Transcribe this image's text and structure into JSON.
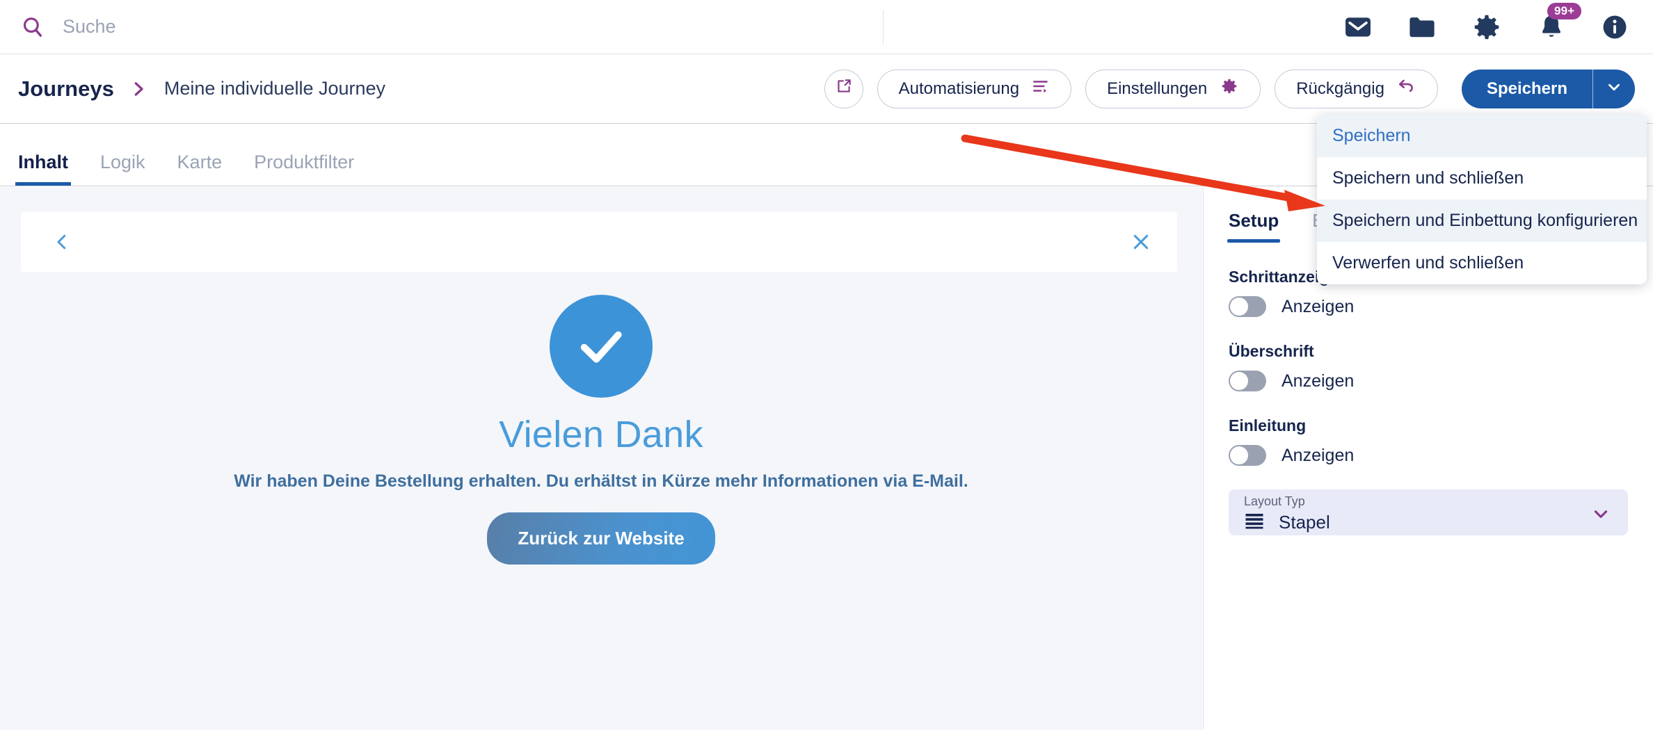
{
  "topbar": {
    "search": {
      "placeholder": "Suche",
      "value": "",
      "icon": "search-icon"
    },
    "icons": [
      {
        "name": "mail-icon",
        "label": "Mail"
      },
      {
        "name": "folder-icon",
        "label": "Ordner"
      },
      {
        "name": "gear-icon",
        "label": "Einstellungen"
      },
      {
        "name": "bell-icon",
        "label": "Benachrichtigungen",
        "badge": "99+"
      },
      {
        "name": "info-icon",
        "label": "Info"
      }
    ],
    "badge_color": "#9b3c96",
    "icon_color": "#233a5e"
  },
  "actionbar": {
    "breadcrumb_root": "Journeys",
    "breadcrumb_leaf": "Meine individuelle Journey",
    "open_external_label": "",
    "automation_label": "Automatisierung",
    "settings_label": "Einstellungen",
    "undo_label": "Rückgängig",
    "save_label": "Speichern",
    "accent_purple": "#8a3a8c",
    "primary_blue": "#1c5aa8"
  },
  "tabs": [
    {
      "label": "Inhalt",
      "active": true
    },
    {
      "label": "Logik",
      "active": false
    },
    {
      "label": "Karte",
      "active": false
    },
    {
      "label": "Produktfilter",
      "active": false
    }
  ],
  "dropdown": {
    "items": [
      {
        "label": "Speichern",
        "state": "current"
      },
      {
        "label": "Speichern und schließen",
        "state": "normal"
      },
      {
        "label": "Speichern und Einbettung konfigurieren",
        "state": "hover"
      },
      {
        "label": "Verwerfen und schließen",
        "state": "normal"
      }
    ]
  },
  "canvas": {
    "preview_back_icon": "chevron-left-icon",
    "preview_close_icon": "close-icon",
    "thanks_title": "Vielen Dank",
    "thanks_subtitle": "Wir haben Deine Bestellung erhalten. Du erhältst in Kürze mehr Informationen via E-Mail.",
    "thanks_button": "Zurück zur Website",
    "check_color": "#3d93d8",
    "title_color": "#4a9cdb",
    "subtitle_color": "#3f6f9e"
  },
  "right_panel": {
    "tabs": [
      {
        "label": "Setup",
        "active": true
      },
      {
        "label": "B",
        "active": false
      }
    ],
    "fields": [
      {
        "label": "Schrittanzeige",
        "toggle_label": "Anzeigen",
        "toggle_on": false
      },
      {
        "label": "Überschrift",
        "toggle_label": "Anzeigen",
        "toggle_on": false
      },
      {
        "label": "Einleitung",
        "toggle_label": "Anzeigen",
        "toggle_on": false
      }
    ],
    "select": {
      "label": "Layout Typ",
      "value": "Stapel",
      "icon": "stack-lines-icon",
      "background": "#e8eaf8"
    }
  },
  "annotation": {
    "arrow_color": "#e8371b",
    "description": "Pfeil zeigt auf Speichern und Einbettung konfigurieren"
  }
}
